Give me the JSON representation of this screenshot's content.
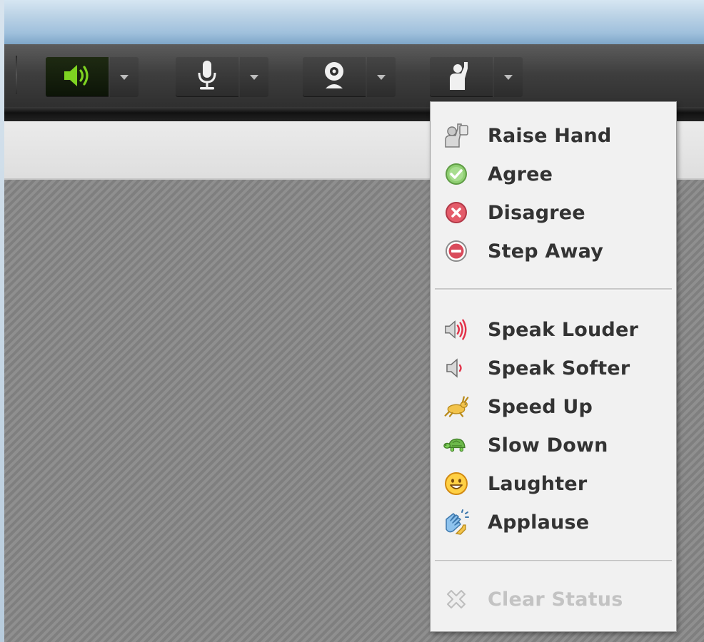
{
  "toolbar": {
    "speaker_button": {
      "icon": "speaker-icon",
      "state": "on",
      "color": "#7ed321"
    },
    "microphone_button": {
      "icon": "microphone-icon"
    },
    "webcam_button": {
      "icon": "webcam-icon"
    },
    "status_button": {
      "icon": "raise-hand-icon"
    }
  },
  "status_menu": {
    "group1": [
      {
        "label": "Raise Hand",
        "icon": "raise-hand-icon"
      },
      {
        "label": "Agree",
        "icon": "agree-check-icon"
      },
      {
        "label": "Disagree",
        "icon": "disagree-x-icon"
      },
      {
        "label": "Step Away",
        "icon": "step-away-icon"
      }
    ],
    "group2": [
      {
        "label": "Speak Louder",
        "icon": "speaker-loud-icon"
      },
      {
        "label": "Speak Softer",
        "icon": "speaker-soft-icon"
      },
      {
        "label": "Speed Up",
        "icon": "rabbit-icon"
      },
      {
        "label": "Slow Down",
        "icon": "turtle-icon"
      },
      {
        "label": "Laughter",
        "icon": "smiley-icon"
      },
      {
        "label": "Applause",
        "icon": "clapping-hands-icon"
      }
    ],
    "clear": {
      "label": "Clear Status",
      "icon": "clear-status-icon",
      "enabled": false
    }
  }
}
